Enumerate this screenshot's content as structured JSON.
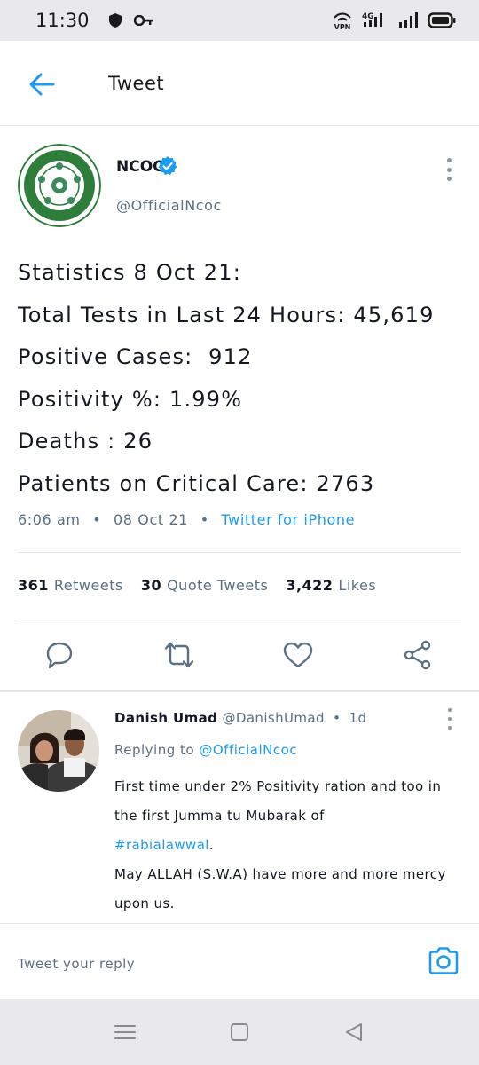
{
  "status_bar": {
    "time": "11:30",
    "left_icons": [
      "shield-icon",
      "key-icon"
    ],
    "right_icons": [
      "vpn-icon",
      "signal-4g-icon",
      "signal-icon",
      "battery-icon"
    ],
    "network_label": "4G",
    "vpn_label": "VPN"
  },
  "header": {
    "title": "Tweet",
    "back_icon": "arrow-left-icon"
  },
  "tweet": {
    "author_name": "NCOC",
    "author_handle": "@OfficialNcoc",
    "verified": true,
    "lines": [
      "Statistics 8 Oct 21:",
      "Total Tests in Last 24 Hours: 45,619",
      "Positive Cases:  912",
      "Positivity %: 1.99%",
      "Deaths : 26",
      "Patients on Critical Care: 2763"
    ],
    "time": "6:06 am",
    "separator": "•",
    "date": "08 Oct 21",
    "source": "Twitter for iPhone"
  },
  "stats": {
    "retweets_count": "361",
    "retweets_label": "Retweets",
    "quotes_count": "30",
    "quotes_label": "Quote Tweets",
    "likes_count": "3,422",
    "likes_label": "Likes"
  },
  "actions": [
    "reply-icon",
    "retweet-icon",
    "like-icon",
    "share-icon"
  ],
  "reply": {
    "author_name": "Danish Umad",
    "author_handle": "@DanishUmad",
    "separator": "•",
    "age": "1d",
    "replying_prefix": "Replying to",
    "replying_mention": "@OfficialNcoc",
    "text_before_hashtag": "First time under 2% Positivity ration and too in the first Jumma tu Mubarak of",
    "hashtag": "#rabialawwal",
    "text_after_hashtag": ".",
    "text_second": "May ALLAH (S.W.A) have more and more mercy upon us."
  },
  "compose": {
    "placeholder": "Tweet your reply",
    "camera_icon": "camera-icon"
  },
  "nav": [
    "menu-icon",
    "home-square-icon",
    "back-triangle-icon"
  ],
  "colors": {
    "accent": "#1d9bf0",
    "text": "#141823",
    "secondary": "#5b7083",
    "divider": "#e3e6e8",
    "system_bar": "#e9e9eb"
  }
}
